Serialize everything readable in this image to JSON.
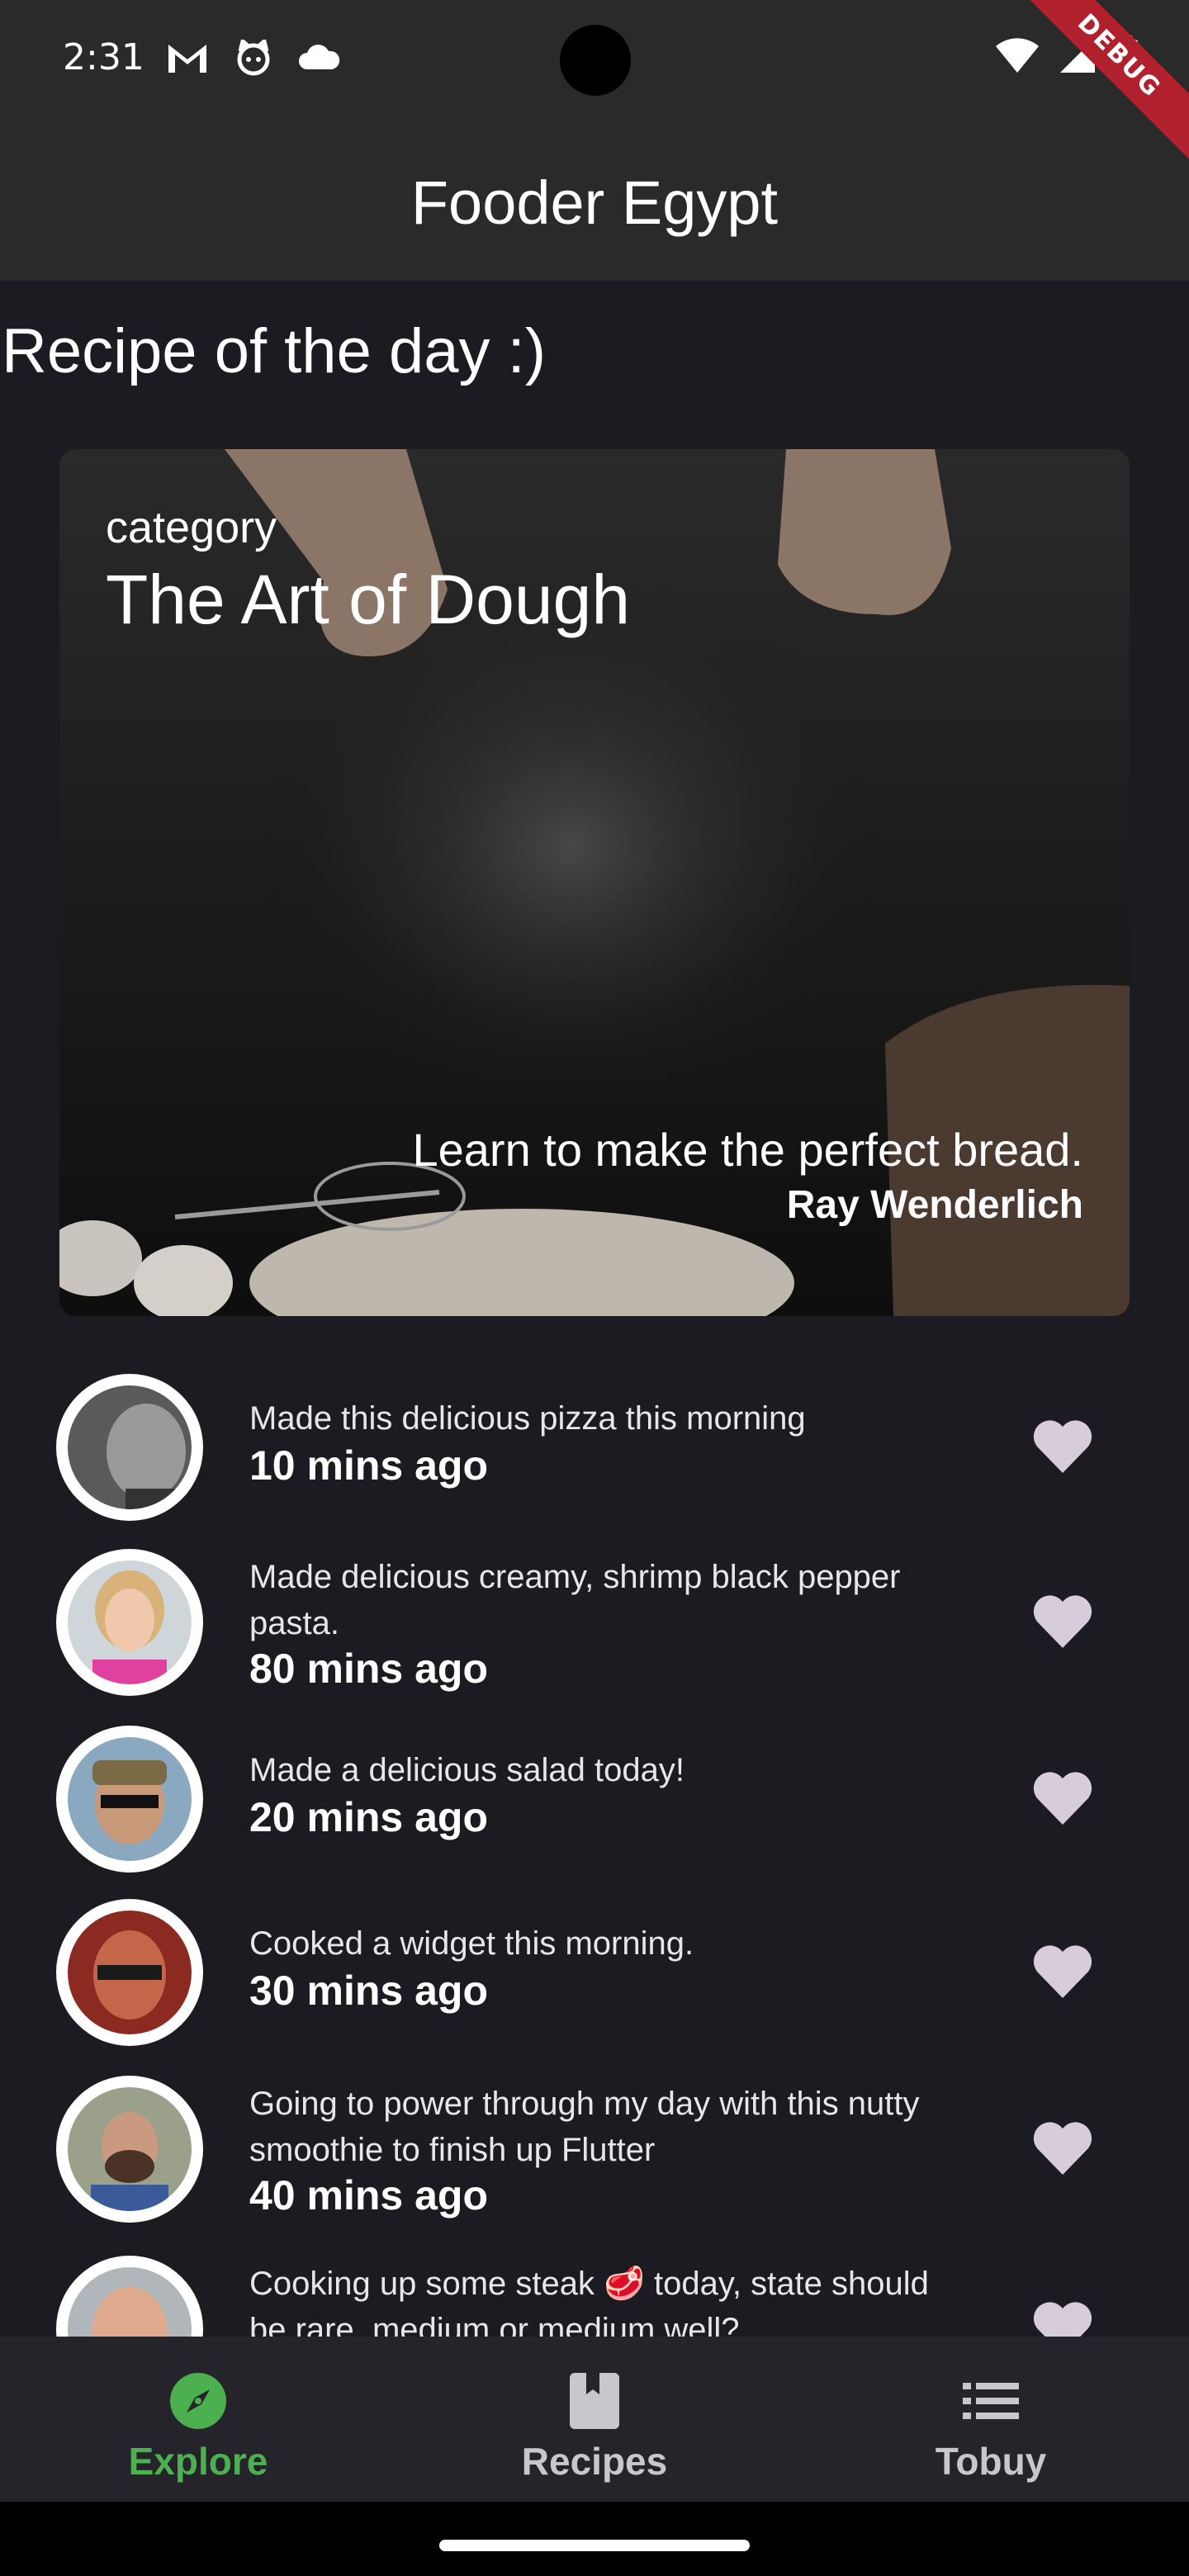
{
  "status_bar": {
    "time": "2:31",
    "left_icons": [
      "gmail-icon",
      "cat-face-icon",
      "cloud-icon"
    ],
    "right_icons": [
      "wifi-icon",
      "cellular-signal-icon",
      "battery-icon"
    ]
  },
  "debug_banner": "DEBUG",
  "app_bar": {
    "title": "Fooder Egypt"
  },
  "section": {
    "heading": "Recipe of the day :)"
  },
  "feature_card": {
    "category": "category",
    "title": "The Art of Dough",
    "description": "Learn to make the perfect bread.",
    "author": "Ray Wenderlich"
  },
  "feed": [
    {
      "text": "Made this delicious pizza this morning",
      "time": "10 mins ago",
      "avatar": "avatar-man-grayscale"
    },
    {
      "text": "Made delicious creamy, shrimp black pepper pasta.",
      "time": "80 mins ago",
      "avatar": "avatar-woman-glasses"
    },
    {
      "text": "Made a delicious salad today!",
      "time": "20 mins ago",
      "avatar": "avatar-man-sunglasses"
    },
    {
      "text": "Cooked a widget this morning.",
      "time": "30 mins ago",
      "avatar": "avatar-man-red-glasses"
    },
    {
      "text": "Going to power through my day with this nutty smoothie to finish up Flutter",
      "time": "40 mins ago",
      "avatar": "avatar-man-beard"
    },
    {
      "text": "Cooking up some steak 🥩 today, state should be rare, medium or medium well?",
      "time": "",
      "avatar": "avatar-man-bald"
    }
  ],
  "bottom_nav": {
    "items": [
      {
        "label": "Explore",
        "icon": "compass-icon",
        "active": true
      },
      {
        "label": "Recipes",
        "icon": "book-icon",
        "active": false
      },
      {
        "label": "Tobuy",
        "icon": "list-icon",
        "active": false
      }
    ]
  },
  "colors": {
    "background": "#1c1b21",
    "app_bar": "#2a2a2a",
    "accent": "#4caf50",
    "heart": "#d7ccd9"
  }
}
